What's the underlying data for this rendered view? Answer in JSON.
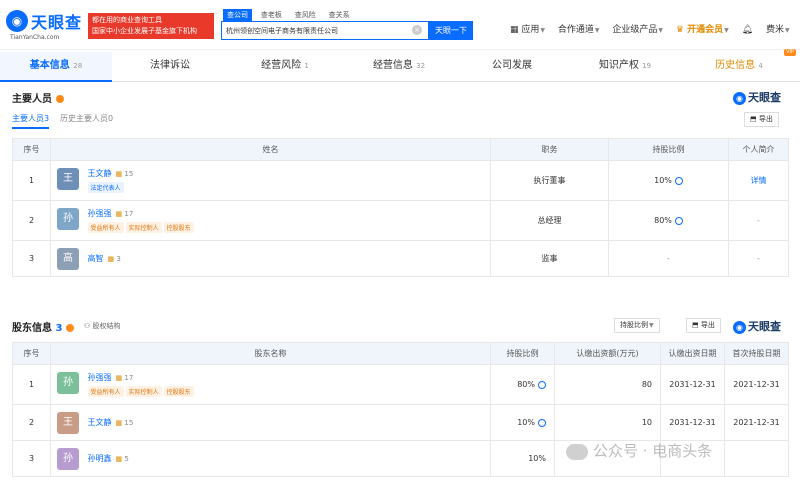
{
  "header": {
    "logo_text": "天眼查",
    "logo_url": "TianYanCha.com",
    "promo_line1": "都在用的商业查询工具",
    "promo_line2": "国家中小企业发展子基金旗下机构",
    "search_tabs": [
      "查公司",
      "查老板",
      "查风险",
      "查关系"
    ],
    "search_value": "杭州领创空间电子商务有限责任公司",
    "search_button": "天眼一下",
    "nav": [
      "应用",
      "合作通道",
      "企业级产品",
      "开通会员",
      "费米"
    ]
  },
  "tabs": [
    {
      "label": "基本信息",
      "count": "28"
    },
    {
      "label": "法律诉讼",
      "count": ""
    },
    {
      "label": "经营风险",
      "count": "1"
    },
    {
      "label": "经营信息",
      "count": "32"
    },
    {
      "label": "公司发展",
      "count": ""
    },
    {
      "label": "知识产权",
      "count": "19"
    },
    {
      "label": "历史信息",
      "count": "4"
    }
  ],
  "vip_badge": "VIP",
  "brand": "天眼查",
  "key_personnel": {
    "title": "主要人员",
    "subtabs": [
      "主要人员3",
      "历史主要人员0"
    ],
    "export": "导出",
    "columns": [
      "序号",
      "姓名",
      "职务",
      "持股比例",
      "个人简介"
    ],
    "rows": [
      {
        "idx": "1",
        "avatar": "王",
        "name": "王文静",
        "shares": "15",
        "tags": [
          "法定代表人"
        ],
        "role": "执行董事",
        "ratio": "10%",
        "bio": "详情"
      },
      {
        "idx": "2",
        "avatar": "孙",
        "name": "孙强强",
        "shares": "17",
        "tags": [
          "受益所有人",
          "实际控制人",
          "控股股东"
        ],
        "role": "总经理",
        "ratio": "80%",
        "bio": "-"
      },
      {
        "idx": "3",
        "avatar": "高",
        "name": "高智",
        "shares": "3",
        "tags": [],
        "role": "监事",
        "ratio": "-",
        "bio": "-"
      }
    ]
  },
  "shareholders": {
    "title": "股东信息",
    "count": "3",
    "equity_structure": "股权结构",
    "ratio_button": "持股比例",
    "export": "导出",
    "columns": [
      "序号",
      "股东名称",
      "持股比例",
      "认缴出资额(万元)",
      "认缴出资日期",
      "首次持股日期"
    ],
    "rows": [
      {
        "idx": "1",
        "avatar": "孙",
        "name": "孙强强",
        "shares": "17",
        "tags": [
          "受益所有人",
          "实际控制人",
          "控股股东"
        ],
        "ratio": "80%",
        "amount": "80",
        "date": "2031-12-31",
        "first": "2021-12-31"
      },
      {
        "idx": "2",
        "avatar": "王",
        "name": "王文静",
        "shares": "15",
        "tags": [],
        "ratio": "10%",
        "amount": "10",
        "date": "2031-12-31",
        "first": "2021-12-31"
      },
      {
        "idx": "3",
        "avatar": "孙",
        "name": "孙明鑫",
        "shares": "5",
        "tags": [],
        "ratio": "10%",
        "amount": "",
        "date": "",
        "first": ""
      }
    ]
  },
  "watermark": "公众号 · 电商头条",
  "colors": {
    "accent": "#0a6cff",
    "promo": "#e8392a",
    "vip": "#e08a00",
    "header_row": "#f0f5fc"
  }
}
